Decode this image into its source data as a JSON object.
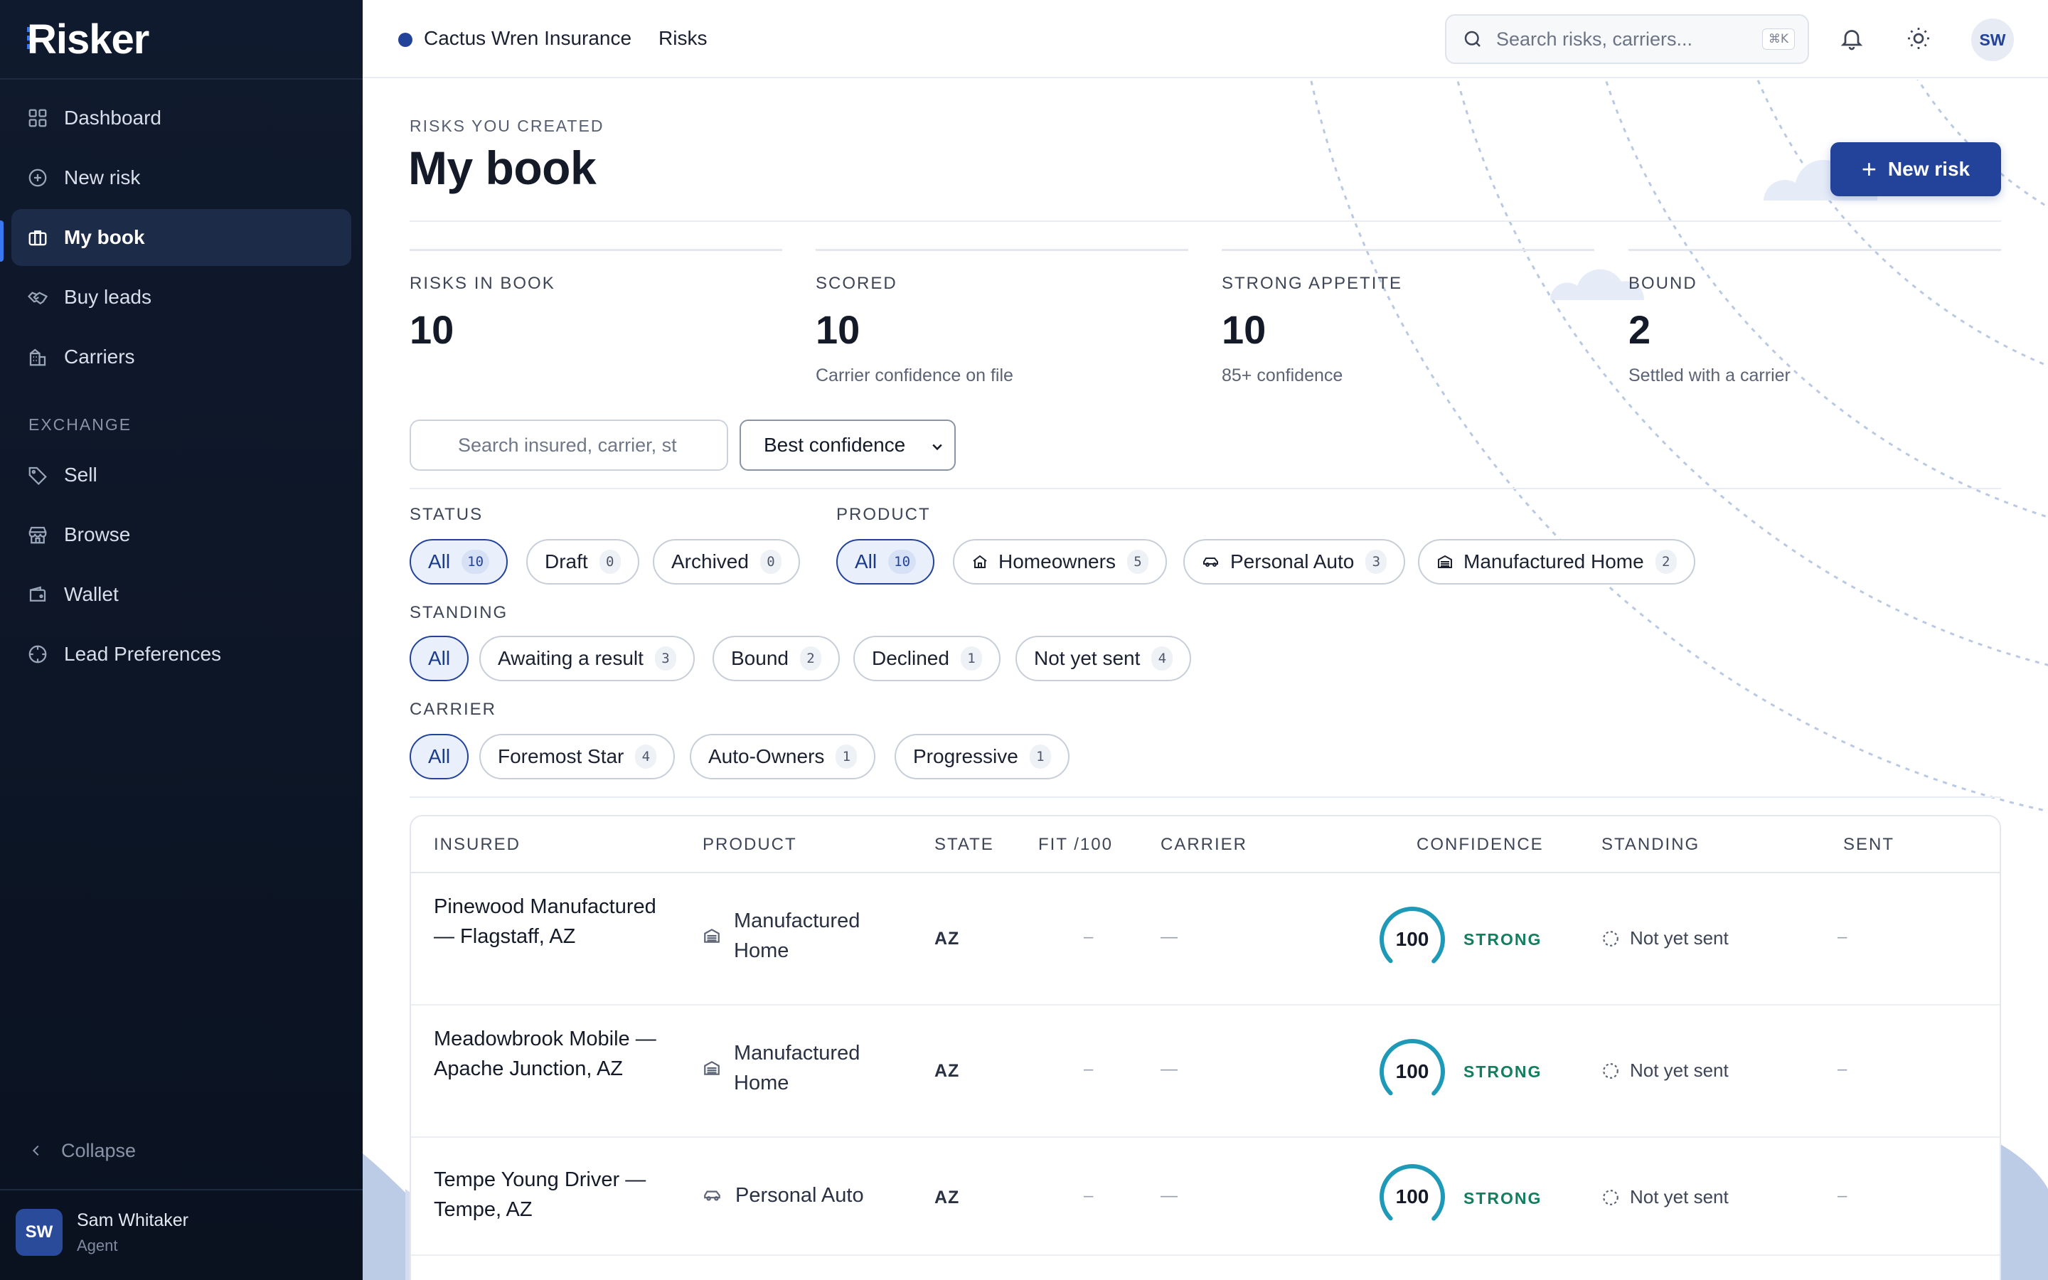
{
  "app": {
    "name": "Risker"
  },
  "sidebar": {
    "nav": [
      {
        "label": "Dashboard",
        "icon": "grid-icon"
      },
      {
        "label": "New risk",
        "icon": "plus-circle-icon"
      },
      {
        "label": "My book",
        "icon": "briefcase-icon",
        "active": true
      },
      {
        "label": "Buy leads",
        "icon": "handshake-icon"
      },
      {
        "label": "Carriers",
        "icon": "building-icon"
      }
    ],
    "exchange_label": "EXCHANGE",
    "exchange": [
      {
        "label": "Sell",
        "icon": "tag-icon"
      },
      {
        "label": "Browse",
        "icon": "store-icon"
      },
      {
        "label": "Wallet",
        "icon": "wallet-icon"
      },
      {
        "label": "Lead Preferences",
        "icon": "target-icon"
      }
    ],
    "collapse_label": "Collapse",
    "user": {
      "initials": "SW",
      "name": "Sam Whitaker",
      "role": "Agent"
    }
  },
  "topbar": {
    "org": "Cactus Wren Insurance",
    "breadcrumb": "Risks",
    "search_placeholder": "Search risks, carriers...",
    "search_shortcut": "⌘K",
    "avatar_initials": "SW"
  },
  "page": {
    "eyebrow": "RISKS YOU CREATED",
    "title": "My book",
    "new_button": "New risk"
  },
  "stats": [
    {
      "label": "RISKS IN BOOK",
      "value": "10",
      "sub": ""
    },
    {
      "label": "SCORED",
      "value": "10",
      "sub": "Carrier confidence on file"
    },
    {
      "label": "STRONG APPETITE",
      "value": "10",
      "sub": "85+ confidence"
    },
    {
      "label": "BOUND",
      "value": "2",
      "sub": "Settled with a carrier"
    }
  ],
  "filters": {
    "search_placeholder": "Search insured, carrier, st",
    "sort_value": "Best confidence",
    "status": {
      "label": "STATUS",
      "options": [
        {
          "label": "All",
          "count": "10"
        },
        {
          "label": "Draft",
          "count": "0"
        },
        {
          "label": "Archived",
          "count": "0"
        }
      ]
    },
    "product": {
      "label": "PRODUCT",
      "options": [
        {
          "label": "All",
          "count": "10"
        },
        {
          "label": "Homeowners",
          "count": "5"
        },
        {
          "label": "Personal Auto",
          "count": "3"
        },
        {
          "label": "Manufactured Home",
          "count": "2"
        }
      ]
    },
    "standing": {
      "label": "STANDING",
      "options": [
        {
          "label": "All",
          "count": ""
        },
        {
          "label": "Awaiting a result",
          "count": "3"
        },
        {
          "label": "Bound",
          "count": "2"
        },
        {
          "label": "Declined",
          "count": "1"
        },
        {
          "label": "Not yet sent",
          "count": "4"
        }
      ]
    },
    "carrier": {
      "label": "CARRIER",
      "options": [
        {
          "label": "All",
          "count": ""
        },
        {
          "label": "Foremost Star",
          "count": "4"
        },
        {
          "label": "Auto-Owners",
          "count": "1"
        },
        {
          "label": "Progressive",
          "count": "1"
        }
      ]
    }
  },
  "table": {
    "columns": [
      "INSURED",
      "PRODUCT",
      "STATE",
      "FIT /100",
      "CARRIER",
      "CONFIDENCE",
      "STANDING",
      "SENT"
    ],
    "rows": [
      {
        "insured": "Pinewood Manufactured — Flagstaff, AZ",
        "product": "Manufactured Home",
        "state": "AZ",
        "fit": "–",
        "carrier": "—",
        "confidence": 100,
        "confidence_label": "STRONG",
        "standing": "Not yet sent",
        "sent": "–"
      },
      {
        "insured": "Meadowbrook Mobile — Apache Junction, AZ",
        "product": "Manufactured Home",
        "state": "AZ",
        "fit": "–",
        "carrier": "—",
        "confidence": 100,
        "confidence_label": "STRONG",
        "standing": "Not yet sent",
        "sent": "–"
      },
      {
        "insured": "Tempe Young Driver — Tempe, AZ",
        "product": "Personal Auto",
        "state": "AZ",
        "fit": "–",
        "carrier": "—",
        "confidence": 100,
        "confidence_label": "STRONG",
        "standing": "Not yet sent",
        "sent": "–"
      }
    ]
  },
  "colors": {
    "brand": "#23439a",
    "sidebar_bg": "#0d1626",
    "strong": "#137e5f",
    "gauge": "#1e9ab8"
  }
}
